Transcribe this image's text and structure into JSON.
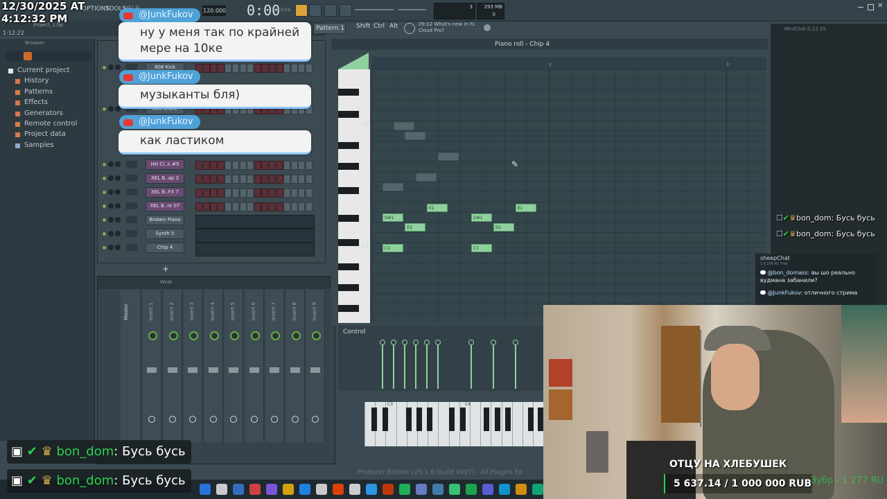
{
  "overlay": {
    "datetime_line1": "12/30/2025 AT",
    "datetime_line2": "4:12:32 PM",
    "donation_title": "ОТЦУ НА ХЛЕБУШЕК",
    "donation_progress": "5 637.14 / 1 000 000 RUB",
    "donation_fraction": 0.0056,
    "donation_faded": "Зубр - 1 277 RU"
  },
  "fl": {
    "menu_options": "OPTIONS",
    "menu_tools": "TOOLS",
    "menu_help": "HELP",
    "tempo": "120.000",
    "time": "0:00",
    "time_unit": "M:S:CS",
    "memory": "293 MB",
    "cpu": "3",
    "voices": "0",
    "pattern": "Pattern 1",
    "btn_shift": "Shift",
    "btn_ctrl": "Ctrl",
    "btn_alt": "Alt",
    "news_time": "09:12",
    "news_text_1": "What's new in FL",
    "news_text_2": "Cloud Pro?",
    "project_file": "Project_1.flp",
    "project_time": "1:12:22",
    "edition": "Producer Edition v25.1.6 [build 4997] - All Plugins Ed"
  },
  "browser": {
    "title": "Browser",
    "items": [
      {
        "label": "Current project",
        "color": "#e0e6e9"
      },
      {
        "label": "History",
        "color": "#d77a4a"
      },
      {
        "label": "Patterns",
        "color": "#d77a4a"
      },
      {
        "label": "Effects",
        "color": "#d77a4a"
      },
      {
        "label": "Generators",
        "color": "#d77a4a"
      },
      {
        "label": "Remote control",
        "color": "#d77a4a"
      },
      {
        "label": "Project data",
        "color": "#d77a4a"
      },
      {
        "label": "Samples",
        "color": "#8fa9c9"
      }
    ]
  },
  "rack": {
    "channels": [
      {
        "label": "808 Kick"
      },
      {
        "label": "808 Snare"
      },
      {
        "label": "HH Cl..k #5"
      },
      {
        "label": "XEL B..ap 3"
      },
      {
        "label": "XEL B..FX 7"
      },
      {
        "label": "XEL B..re 07"
      },
      {
        "label": "Broken Piano"
      },
      {
        "label": "Synth 5"
      },
      {
        "label": "Chip 4"
      }
    ],
    "add_label": "+"
  },
  "chat_bubbles": [
    {
      "user": "@JunkFukov",
      "text_1": "ну у меня так по крайней",
      "text_2": "мере на 10ке"
    },
    {
      "user": "@JunkFukov",
      "text_1": "музыканты бля)",
      "text_2": ""
    },
    {
      "user": "@JunkFukov",
      "text_1": "как ластиком",
      "text_2": ""
    }
  ],
  "mixer": {
    "toolbar_label": "Wide",
    "master": "Master",
    "inserts": [
      "Insert 1",
      "Insert 2",
      "Insert 3",
      "Insert 4",
      "Insert 5",
      "Insert 6",
      "Insert 7",
      "Insert 8",
      "Insert 9"
    ]
  },
  "pianoroll": {
    "title": "Piano roll - Chip 4",
    "bar_2": "2",
    "bar_3": "3",
    "key_c2": "C2",
    "key_c1": "C1",
    "control_label": "Control",
    "kb_c3": "C3",
    "kb_c4": "C4",
    "notes": [
      {
        "label": "D#1"
      },
      {
        "label": "D1"
      },
      {
        "label": "C1"
      },
      {
        "label": "E1"
      },
      {
        "label": "D#1"
      },
      {
        "label": "D1"
      },
      {
        "label": "C1"
      },
      {
        "label": "E1"
      }
    ]
  },
  "minichat": {
    "title": "MiniChat 0.12.25",
    "messages": [
      {
        "user": "bon_dom",
        "text": "Бусь бусь"
      },
      {
        "user": "bon_dom",
        "text": "Бусь бусь"
      }
    ]
  },
  "sheepchat": {
    "title": "sheepChat",
    "version": "1.9.190 RC Free",
    "msg1_user": "@bon_domass:",
    "msg1_text_1": "вы шо реально",
    "msg1_text_2": "вудмана забанили?",
    "msg2_user": "@JunkFukov:",
    "msg2_text": "отличного стрима"
  },
  "bottom_chat": [
    {
      "user": "bon_dom",
      "sep": ":",
      "text": "Бусь бусь"
    },
    {
      "user": "bon_dom",
      "sep": ":",
      "text": "Бусь бусь"
    }
  ],
  "colors": {
    "note_green": "#8fd19e",
    "step_red": "#5c2f36",
    "bubble_tag": "#4fa2d8",
    "youtube_red": "#e53935",
    "twitch_purple": "#9146ff",
    "donation_green": "#2bd24f"
  }
}
